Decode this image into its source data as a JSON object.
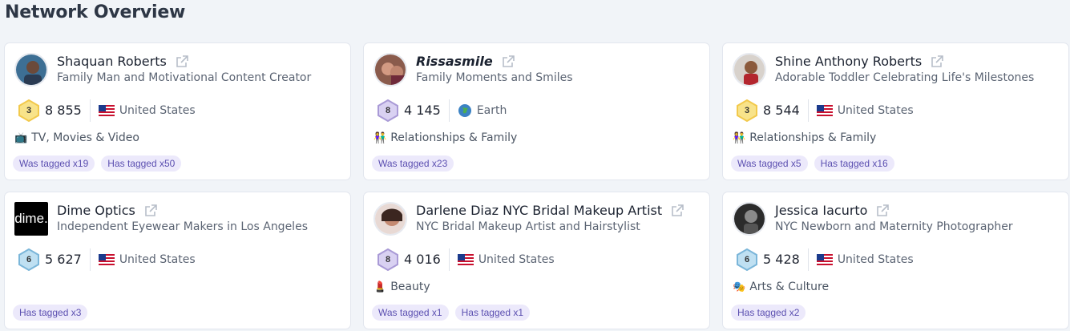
{
  "page_title": "Network Overview",
  "colors": {
    "accent": "#5b4fb0",
    "tag_bg": "#ece9fb",
    "level3": "#f2c94c",
    "level6": "#7bb6d9",
    "level8": "#a99ad6"
  },
  "cards": [
    {
      "name": "Shaquan Roberts",
      "description": "Family Man and Motivational Content Creator",
      "level": "3",
      "count": "8 855",
      "location": "United States",
      "location_icon": "us-flag-icon",
      "category": "TV, Movies & Video",
      "category_icon": "tv-icon",
      "tags": [
        "Was tagged x19",
        "Has tagged x50"
      ]
    },
    {
      "name": "Rissasmile",
      "description": "Family Moments and Smiles",
      "level": "8",
      "count": "4 145",
      "location": "Earth",
      "location_icon": "globe-icon",
      "category": "Relationships & Family",
      "category_icon": "family-icon",
      "tags": [
        "Was tagged x23"
      ]
    },
    {
      "name": "Shine Anthony Roberts",
      "description": "Adorable Toddler Celebrating Life's Milestones",
      "level": "3",
      "count": "8 544",
      "location": "United States",
      "location_icon": "us-flag-icon",
      "category": "Relationships & Family",
      "category_icon": "family-icon",
      "tags": [
        "Was tagged x5",
        "Has tagged x16"
      ]
    },
    {
      "name": "Dime Optics",
      "avatar_text": "dime.",
      "description": "Independent Eyewear Makers in Los Angeles",
      "level": "6",
      "count": "5 627",
      "location": "United States",
      "location_icon": "us-flag-icon",
      "category": "",
      "tags": [
        "Has tagged x3"
      ]
    },
    {
      "name": "Darlene Diaz NYC Bridal Makeup Artist",
      "description": "NYC Bridal Makeup Artist and Hairstylist",
      "level": "8",
      "count": "4 016",
      "location": "United States",
      "location_icon": "us-flag-icon",
      "category": "Beauty",
      "category_icon": "lipstick-icon",
      "tags": [
        "Was tagged x1",
        "Has tagged x1"
      ]
    },
    {
      "name": "Jessica Iacurto",
      "description": "NYC Newborn and Maternity Photographer",
      "level": "6",
      "count": "5 428",
      "location": "United States",
      "location_icon": "us-flag-icon",
      "category": "Arts & Culture",
      "category_icon": "theater-masks-icon",
      "tags": [
        "Has tagged x2"
      ]
    }
  ]
}
